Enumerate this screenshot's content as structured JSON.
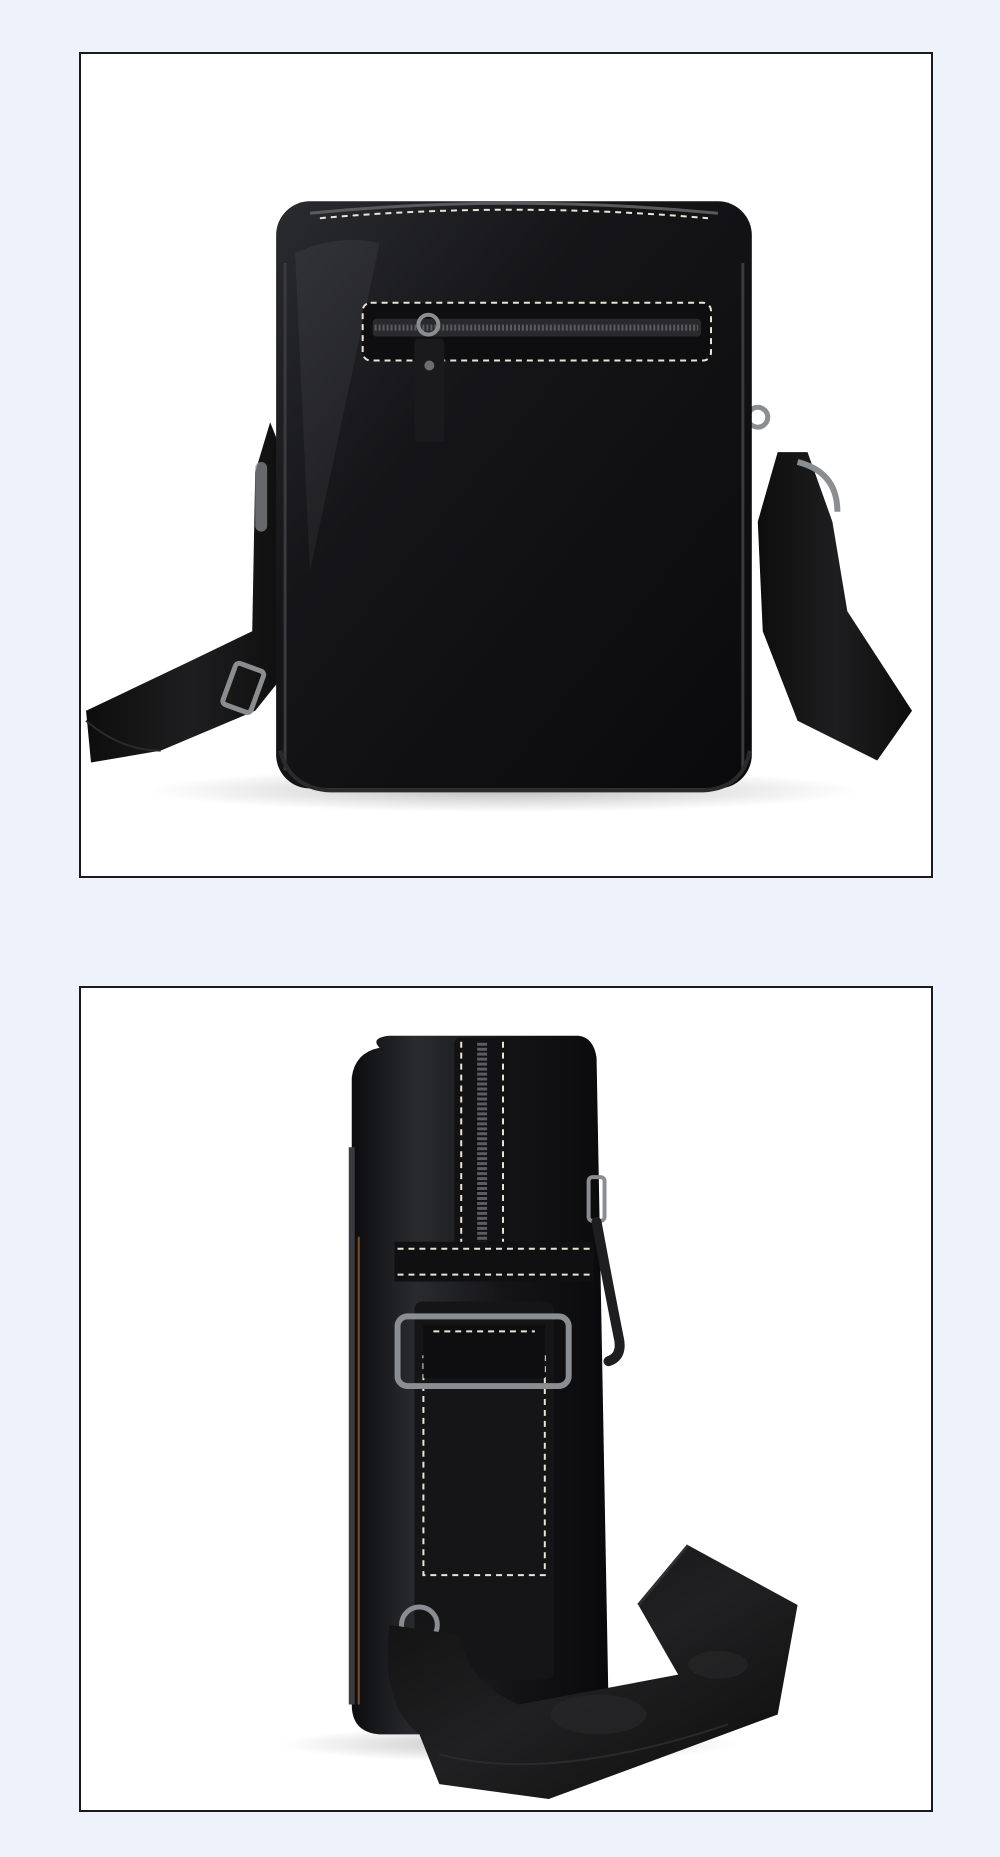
{
  "page": {
    "background_color": "#eef3fb",
    "frame_border_color": "#1b1b1b"
  },
  "photos": [
    {
      "view": "front",
      "subject_icon": "crossbody-bag-front-icon",
      "colors": {
        "leather": "#141416",
        "stitching": "#e9e4d6",
        "strap": "#121212",
        "hardware": "#8a8d92"
      }
    },
    {
      "view": "side",
      "subject_icon": "crossbody-bag-side-icon",
      "colors": {
        "leather": "#141416",
        "stitching": "#e9e4d6",
        "strap": "#121212",
        "hardware": "#8a8d92"
      }
    }
  ]
}
